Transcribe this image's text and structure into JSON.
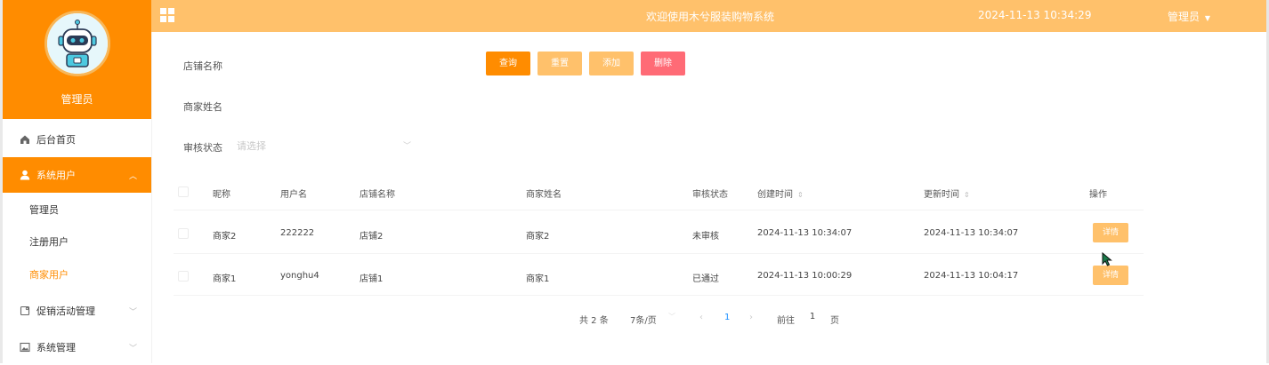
{
  "colors": {
    "accent": "#ff8c00",
    "accent_light": "#ffc16b",
    "danger": "#ff6b76",
    "link": "#1e90ff"
  },
  "sidebar": {
    "profile_name": "管理员",
    "menu": [
      {
        "label": "后台首页",
        "icon": "home-icon"
      },
      {
        "label": "系统用户",
        "icon": "user-icon",
        "expanded": true,
        "children": [
          "管理员",
          "注册用户",
          "商家用户"
        ],
        "active_child": "商家用户"
      },
      {
        "label": "促销活动管理",
        "icon": "tag-icon"
      },
      {
        "label": "系统管理",
        "icon": "image-icon"
      }
    ]
  },
  "header": {
    "title": "欢迎使用木兮服装购物系统",
    "datetime": "2024-11-13 10:34:29",
    "user_menu": "管理员"
  },
  "filters": {
    "shop_name_label": "店铺名称",
    "merchant_name_label": "商家姓名",
    "status_label": "审核状态",
    "status_placeholder": "请选择",
    "buttons": {
      "query": "查询",
      "reset": "重置",
      "add": "添加",
      "delete": "删除"
    }
  },
  "table": {
    "columns": [
      "昵称",
      "用户名",
      "店铺名称",
      "商家姓名",
      "审核状态",
      "创建时间",
      "更新时间",
      "操作"
    ],
    "rows": [
      [
        "商家2",
        "222222",
        "店铺2",
        "商家2",
        "未审核",
        "2024-11-13 10:34:07",
        "2024-11-13 10:34:07"
      ],
      [
        "商家1",
        "yonghu4",
        "店铺1",
        "商家1",
        "已通过",
        "2024-11-13 10:00:29",
        "2024-11-13 10:04:17"
      ]
    ],
    "action_label": "详情"
  },
  "pagination": {
    "total": "共 2 条",
    "page_size": "7条/页",
    "current_page": "1",
    "goto_prefix": "前往",
    "goto_value": "1",
    "goto_suffix": "页"
  }
}
